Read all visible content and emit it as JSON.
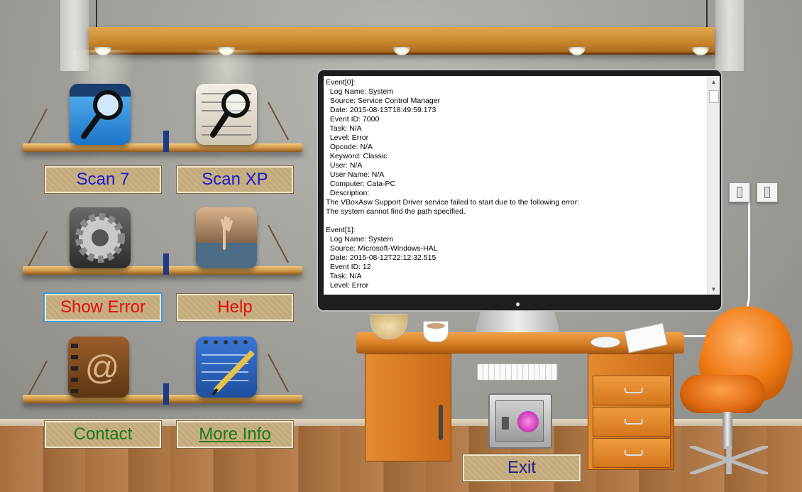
{
  "window": {
    "title": ""
  },
  "buttons": {
    "scan7": "Scan 7",
    "scanxp": "Scan XP",
    "show_error": "Show Error",
    "help": "Help",
    "contact": "Contact",
    "more_info": "More Info",
    "exit": "Exit"
  },
  "button_colors": {
    "scan7": "#1a1ad6",
    "scanxp": "#1a1ad6",
    "show_error": "#e01010",
    "help": "#e01010",
    "contact": "#1d7a1d",
    "more_info": "#1d7a1d",
    "exit": "#1a1a90"
  },
  "log_text": "Event[0]:\n  Log Name: System\n  Source: Service Control Manager\n  Date: 2015-08-13T18:49:59.173\n  Event ID: 7000\n  Task: N/A\n  Level: Error\n  Opcode: N/A\n  Keyword: Classic\n  User: N/A\n  User Name: N/A\n  Computer: Cata-PC\n  Description:\nThe VBoxAsw Support Driver service failed to start due to the following error:\nThe system cannot find the path specified.\n\nEvent[1]:\n  Log Name: System\n  Source: Microsoft-Windows-HAL\n  Date: 2015-08-12T22:12:32.515\n  Event ID: 12\n  Task: N/A\n  Level: Error",
  "icons": {
    "scan7": "magnifier-folder-icon",
    "scanxp": "magnifier-document-icon",
    "settings": "gear-icon",
    "help": "drowning-hand-icon",
    "contact": "address-book-icon",
    "notes": "notepad-pencil-icon",
    "safe": "safe-apple-icon"
  }
}
